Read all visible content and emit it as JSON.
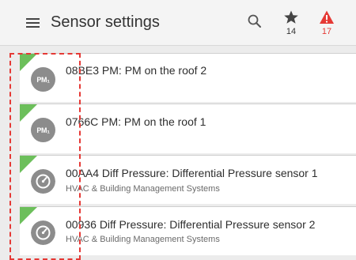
{
  "header": {
    "title": "Sensor settings",
    "starred_count": "14",
    "alert_count": "17"
  },
  "colors": {
    "accent_green": "#6cbf5b",
    "alert_red": "#e53935",
    "avatar_gray": "#8c8c8c"
  },
  "sensors": [
    {
      "name": "08BE3 PM: PM on the roof 2",
      "subtitle": "",
      "icon": "pm-icon"
    },
    {
      "name": "0766C PM: PM on the roof 1",
      "subtitle": "",
      "icon": "pm-icon"
    },
    {
      "name": "00AA4 Diff Pressure: Differential Pressure sensor 1",
      "subtitle": "HVAC & Building Management Systems",
      "icon": "gauge-icon"
    },
    {
      "name": "00936 Diff Pressure: Differential Pressure sensor 2",
      "subtitle": "HVAC & Building Management Systems",
      "icon": "gauge-icon"
    }
  ],
  "pm_icon_text": "PM₁"
}
